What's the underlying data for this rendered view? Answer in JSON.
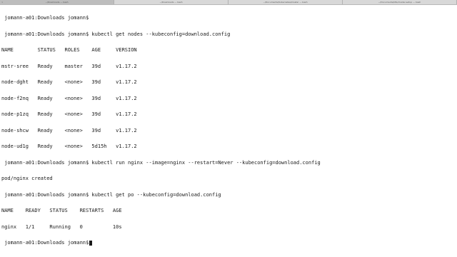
{
  "tabs": [
    {
      "label": "~/Downloads — bash",
      "active": true
    },
    {
      "label": "~/Downloads — bash",
      "active": false
    },
    {
      "label": "~/Documents/Kubernetes/kluster — bash",
      "active": false
    },
    {
      "label": "~/Documents/k8s/cluster-setup — bash",
      "active": false
    }
  ],
  "terminal": {
    "lines": [
      " jomann-a01:Downloads jomann$",
      " jomann-a01:Downloads jomann$ kubectl get nodes --kubeconfig=download.config",
      "NAME        STATUS   ROLES    AGE     VERSION",
      "mstr-sree   Ready    master   39d     v1.17.2",
      "node-dght   Ready    <none>   39d     v1.17.2",
      "node-f2nq   Ready    <none>   39d     v1.17.2",
      "node-p1zq   Ready    <none>   39d     v1.17.2",
      "node-shcw   Ready    <none>   39d     v1.17.2",
      "node-ud1g   Ready    <none>   5d15h   v1.17.2",
      " jomann-a01:Downloads jomann$ kubectl run nginx --image=nginx --restart=Never --kubeconfig=download.config",
      "pod/nginx created",
      " jomann-a01:Downloads jomann$ kubectl get po --kubeconfig=download.config",
      "NAME    READY   STATUS    RESTARTS   AGE",
      "nginx   1/1     Running   0          10s"
    ],
    "prompt": " jomann-a01:Downloads jomann$"
  }
}
